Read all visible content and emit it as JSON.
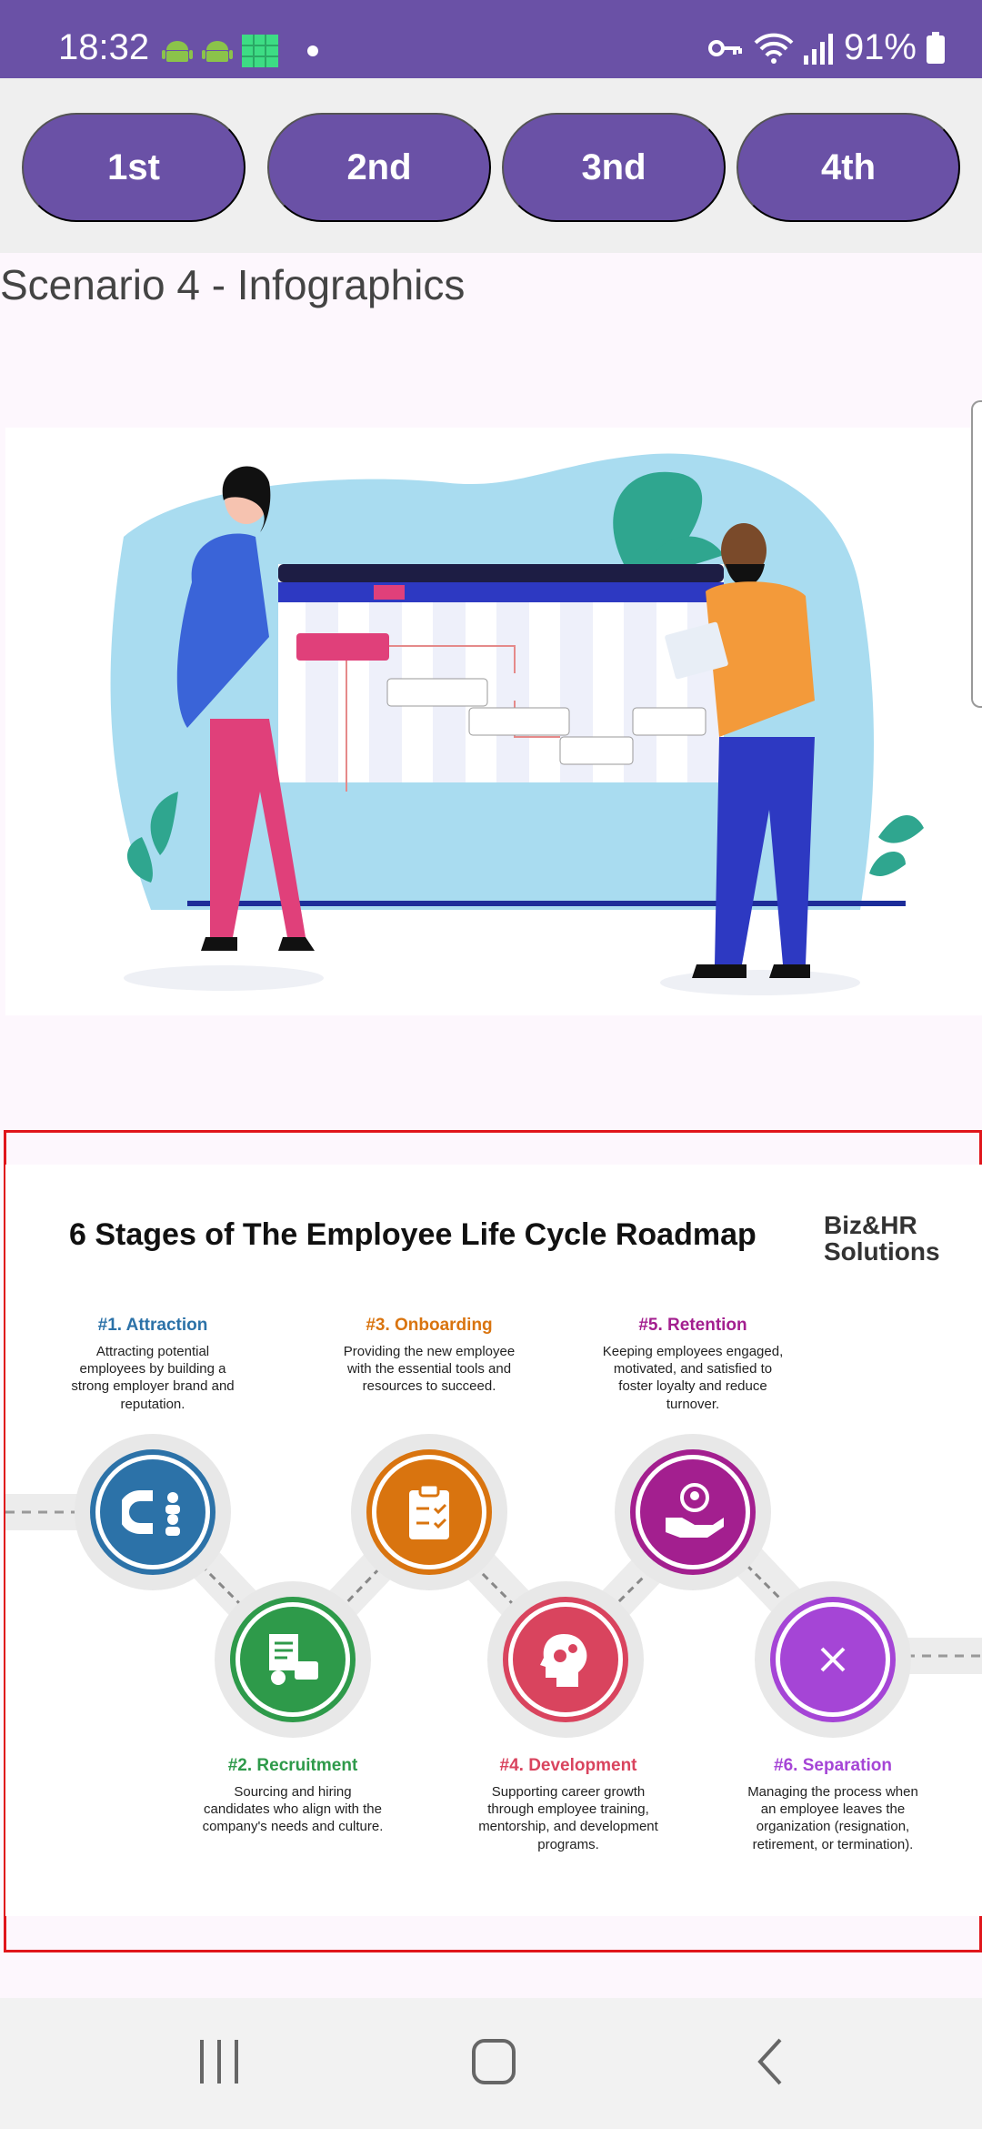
{
  "status": {
    "time": "18:32",
    "battery": "91%"
  },
  "tabs": [
    {
      "label": "1st"
    },
    {
      "label": "2nd"
    },
    {
      "label": "3nd"
    },
    {
      "label": "4th"
    }
  ],
  "scenario_title": "Scenario 4 - Infographics",
  "infographic": {
    "title": "6 Stages of The Employee Life Cycle Roadmap",
    "brand_line1": "Biz&HR",
    "brand_line2": "Solutions",
    "stages": [
      {
        "title": "#1. Attraction",
        "desc": "Attracting potential employees by building a strong employer brand and reputation.",
        "color": "#2c72a8"
      },
      {
        "title": "#2. Recruitment",
        "desc": "Sourcing and hiring candidates who align with the company's needs and culture.",
        "color": "#2e9a4a"
      },
      {
        "title": "#3. Onboarding",
        "desc": "Providing the new employee with the essential tools and resources to succeed.",
        "color": "#d9740f"
      },
      {
        "title": "#4. Development",
        "desc": "Supporting career growth through employee training, mentorship, and development programs.",
        "color": "#d9445e"
      },
      {
        "title": "#5. Retention",
        "desc": "Keeping employees engaged, motivated, and satisfied to foster loyalty and reduce turnover.",
        "color": "#a31f8f"
      },
      {
        "title": "#6. Separation",
        "desc": "Managing the process when an employee leaves the organization (resignation, retirement, or termination).",
        "color": "#a545d6"
      }
    ]
  },
  "icons": {
    "status": [
      "android-icon",
      "android-icon",
      "grid-icon",
      "key-icon",
      "wifi-icon",
      "signal-icon",
      "battery-icon"
    ],
    "nav": [
      "recent-apps-icon",
      "home-icon",
      "back-icon"
    ]
  },
  "colors": {
    "primary": "#6a51a6",
    "highlight_border": "#e0161c"
  }
}
